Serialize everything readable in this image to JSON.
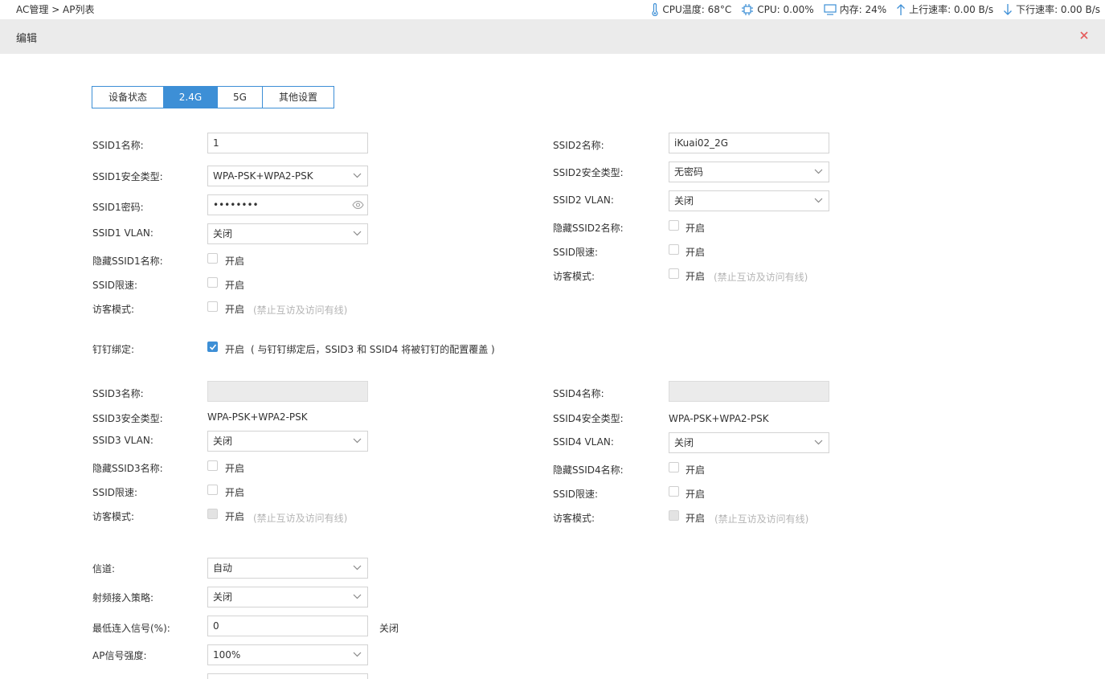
{
  "breadcrumb": "AC管理 > AP列表",
  "stats": {
    "cpu_temp": "CPU温度: 68°C",
    "cpu": "CPU: 0.00%",
    "memory": "内存: 24%",
    "upload": "上行速率: 0.00 B/s",
    "download": "下行速率: 0.00 B/s"
  },
  "editbar": {
    "title": "编辑"
  },
  "tabs": [
    "设备状态",
    "2.4G",
    "5G",
    "其他设置"
  ],
  "active_tab": "2.4G",
  "ssid1": {
    "name_label": "SSID1名称:",
    "name_value": "1",
    "security_label": "SSID1安全类型:",
    "security_value": "WPA-PSK+WPA2-PSK",
    "password_label": "SSID1密码:",
    "password_value": "••••••••",
    "vlan_label": "SSID1 VLAN:",
    "vlan_value": "关闭",
    "hide_label": "隐藏SSID1名称:",
    "limit_label": "SSID限速:",
    "guest_label": "访客模式:"
  },
  "ssid2": {
    "name_label": "SSID2名称:",
    "name_value": "iKuai02_2G",
    "security_label": "SSID2安全类型:",
    "security_value": "无密码",
    "vlan_label": "SSID2 VLAN:",
    "vlan_value": "关闭",
    "hide_label": "隐藏SSID2名称:",
    "limit_label": "SSID限速:",
    "guest_label": "访客模式:"
  },
  "enable_text": "开启",
  "guest_hint": "(禁止互访及访问有线)",
  "dingtalk": {
    "label": "钉钉绑定:",
    "checked": true,
    "note": "( 与钉钉绑定后，SSID3 和 SSID4 将被钉钉的配置覆盖 )"
  },
  "ssid3": {
    "name_label": "SSID3名称:",
    "name_value": "",
    "security_label": "SSID3安全类型:",
    "security_value": "WPA-PSK+WPA2-PSK",
    "vlan_label": "SSID3 VLAN:",
    "vlan_value": "关闭",
    "hide_label": "隐藏SSID3名称:",
    "limit_label": "SSID限速:",
    "guest_label": "访客模式:"
  },
  "ssid4": {
    "name_label": "SSID4名称:",
    "name_value": "",
    "security_label": "SSID4安全类型:",
    "security_value": "WPA-PSK+WPA2-PSK",
    "vlan_label": "SSID4 VLAN:",
    "vlan_value": "关闭",
    "hide_label": "隐藏SSID4名称:",
    "limit_label": "SSID限速:",
    "guest_label": "访客模式:"
  },
  "radio": {
    "channel_label": "信道:",
    "channel_value": "自动",
    "access_label": "射频接入策略:",
    "access_value": "关闭",
    "min_signal_label": "最低连入信号(%):",
    "min_signal_value": "0",
    "min_signal_status": "关闭",
    "strength_label": "AP信号强度:",
    "strength_value": "100%"
  },
  "colors": {
    "accent": "#3d8fd6",
    "close": "#e55b5b",
    "hint": "#b5b5b5"
  }
}
